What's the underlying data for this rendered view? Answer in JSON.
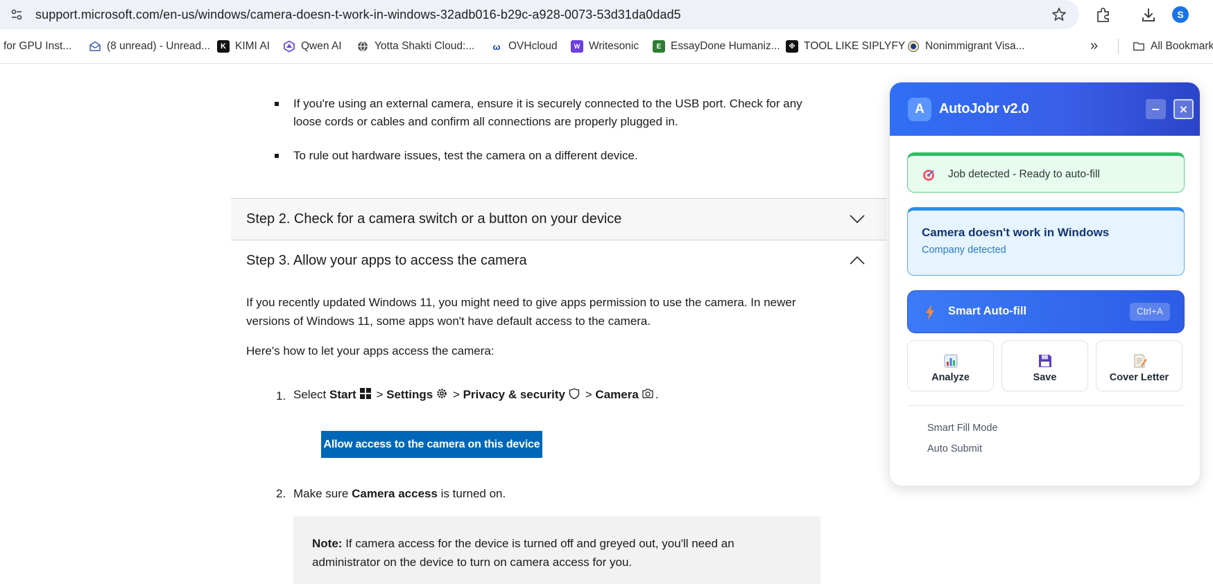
{
  "browser": {
    "url": "support.microsoft.com/en-us/windows/camera-doesn-t-work-in-windows-32adb016-b29c-a928-0073-53d31da0dad5",
    "profile_initial": "S",
    "bookmarks": [
      {
        "label": "for GPU Inst...",
        "icon": "none"
      },
      {
        "label": "(8 unread) - Unread...",
        "icon": "mail-icon"
      },
      {
        "label": "KIMI AI",
        "icon": "kimi-logo-icon"
      },
      {
        "label": "Qwen AI",
        "icon": "qwen-logo-icon"
      },
      {
        "label": "Yotta Shakti Cloud:...",
        "icon": "globe-icon"
      },
      {
        "label": "OVHcloud",
        "icon": "ovh-logo-icon"
      },
      {
        "label": "Writesonic",
        "icon": "writesonic-logo-icon"
      },
      {
        "label": "EssayDone Humaniz...",
        "icon": "essaydone-logo-icon"
      },
      {
        "label": "TOOL LIKE SIPLYFY",
        "icon": "tool-logo-icon"
      },
      {
        "label": "Nonimmigrant Visa...",
        "icon": "seal-icon"
      }
    ],
    "bookmarks_more": "»",
    "all_bookmarks": "All Bookmarks"
  },
  "article": {
    "bullets": [
      "If you're using an external camera, ensure it is securely connected to the USB port. Check for any loose cords or cables and confirm all connections are properly plugged in.",
      "To rule out hardware issues, test the camera on a different device."
    ],
    "step2_title": "Step 2. Check for a camera switch or a button on your device",
    "step3_title": "Step 3. Allow your apps to access the camera",
    "intro": "If you recently updated Windows 11, you might need to give apps permission to use the camera. In newer versions of Windows 11, some apps won't have default access to the camera.",
    "howto": "Here's how to let your apps access the camera:",
    "steps": {
      "s1_num": "1.",
      "s1_select": "Select",
      "s1_start": "Start",
      "s1_settings": "Settings",
      "s1_privacy": "Privacy & security",
      "s1_camera": "Camera",
      "sep": ">",
      "end": ".",
      "s2_num": "2.",
      "s2_pre": "Make sure",
      "s2_bold": "Camera access",
      "s2_post": "is turned on."
    },
    "allow_button": "Allow access to the camera on this device",
    "note_label": "Note:",
    "note_text": "If camera access for the device is turned off and greyed out, you'll need an administrator on the device to turn on camera access for you."
  },
  "autojobr": {
    "logo_letter": "A",
    "title": "AutoJobr v2.0",
    "min_label": "−",
    "close_label": "×",
    "status": "Job detected - Ready to auto-fill",
    "job_title": "Camera doesn't work in Windows",
    "company_sub": "Company detected",
    "autofill_label": "Smart Auto-fill",
    "shortcut": "Ctrl+A",
    "tiles": [
      {
        "label": "Analyze",
        "icon": "bar-chart-icon"
      },
      {
        "label": "Save",
        "icon": "floppy-disk-icon"
      },
      {
        "label": "Cover Letter",
        "icon": "memo-icon"
      }
    ],
    "options": [
      "Smart Fill Mode",
      "Auto Submit"
    ],
    "colors": {
      "header": "#2f6ff5",
      "status_accent": "#2fbf63",
      "company_accent": "#2d8ee6",
      "autofill": "#3b7bf6"
    }
  },
  "colors": {
    "ms_blue": "#0067b8",
    "urlbar": "#eef1f7"
  }
}
